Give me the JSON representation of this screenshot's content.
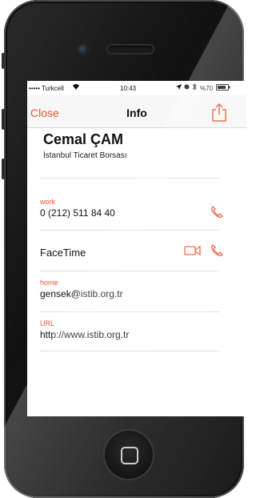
{
  "status_bar": {
    "carrier": "••••• Turkcell",
    "time": "10:43",
    "battery": "%70"
  },
  "navbar": {
    "close_label": "Close",
    "title": "Info"
  },
  "contact": {
    "name": "Cemal ÇAM",
    "company": "İstanbul Ticaret Borsası"
  },
  "fields": {
    "phone": {
      "label": "work",
      "value": "0 (212) 511 84 40"
    },
    "facetime": {
      "label": "FaceTime"
    },
    "email": {
      "label": "home",
      "value": "gensek@istib.org.tr"
    },
    "url": {
      "label": "URL",
      "value": "http://www.istib.org.tr"
    }
  },
  "colors": {
    "accent": "#e9572d",
    "phone_body": "#1a1a1a"
  },
  "icons": [
    "share-icon",
    "phone-icon",
    "video-icon",
    "wifi-icon",
    "battery-icon"
  ]
}
